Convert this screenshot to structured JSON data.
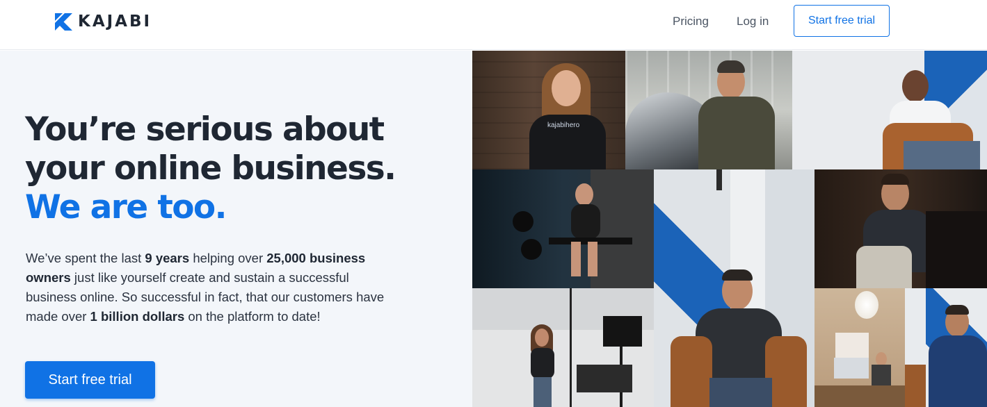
{
  "header": {
    "brand": "KAJABI",
    "nav": {
      "pricing": "Pricing",
      "login": "Log in",
      "cta": "Start free trial"
    }
  },
  "hero": {
    "headline_line1": "You’re serious about",
    "headline_line2": "your online business.",
    "headline_accent": "We are too.",
    "body": {
      "t1": "We’ve spent the last ",
      "b1": "9 years",
      "t2": " helping over ",
      "b2": "25,000 business owners",
      "t3": " just like yourself create and sustain a successful business online. So successful in fact, that our customers have made over ",
      "b3": "1 billion dollars",
      "t4": " on the platform to date!"
    },
    "cta": "Start free trial"
  },
  "photos": [
    {
      "name": "photo-woman-kajabi-hero-shirt",
      "shirt_text": "kajabihero"
    },
    {
      "name": "photo-man-on-motorcycle"
    },
    {
      "name": "photo-man-in-chair-white-shirt"
    },
    {
      "name": "photo-woman-in-gym"
    },
    {
      "name": "photo-man-glasses-speaking"
    },
    {
      "name": "photo-man-dark-shirt"
    },
    {
      "name": "photo-woman-in-studio"
    },
    {
      "name": "photo-woman-office-desk"
    },
    {
      "name": "photo-man-blue-shirt"
    }
  ],
  "colors": {
    "brand_blue": "#1072e5",
    "text_dark": "#1f2733",
    "hero_bg": "#f3f6fa"
  }
}
